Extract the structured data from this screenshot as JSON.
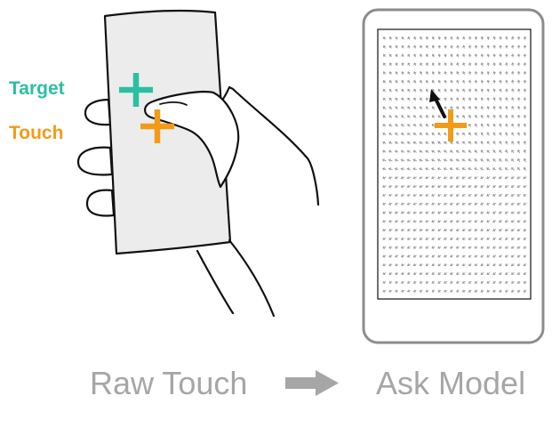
{
  "labels": {
    "target": "Target",
    "touch": "Touch",
    "raw_touch": "Raw Touch",
    "ask_model": "Ask Model"
  },
  "colors": {
    "target": "#2bbfa2",
    "touch": "#f29b19",
    "caption": "#a6a6a6",
    "arrow": "#a6a6a6",
    "outline": "#111111",
    "phone_fill": "#ececec",
    "field_vector": "#9a9a9a",
    "correction_arrow": "#111111"
  },
  "icons": {
    "target_marker": "plus-marker-icon",
    "touch_marker": "plus-marker-icon",
    "flow_arrow": "right-arrow-icon",
    "correction_arrow": "arrow-icon"
  }
}
